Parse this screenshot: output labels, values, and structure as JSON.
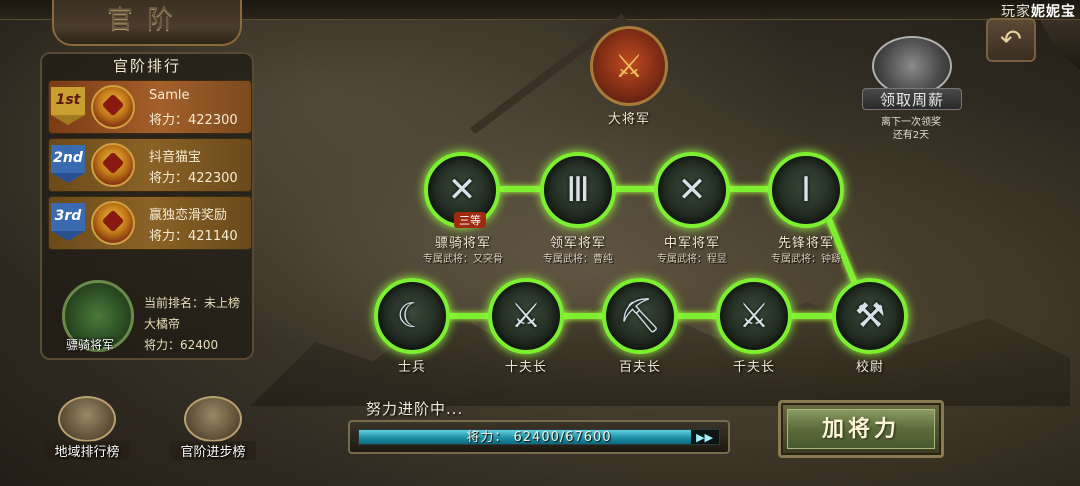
{
  "header": {
    "title": "官阶",
    "player_prefix": "玩家",
    "player_name": "妮妮宝"
  },
  "ranking": {
    "title": "官阶排行",
    "entries": [
      {
        "badge": "1st",
        "name": "Samle",
        "power_label": "将力：",
        "power": "422300"
      },
      {
        "badge": "2nd",
        "name": "抖音猫宝",
        "power_label": "将力：",
        "power": "422300"
      },
      {
        "badge": "3rd",
        "name": "赢独恋滑奖励",
        "power_label": "将力：",
        "power": "421140"
      }
    ],
    "mine": {
      "rank_title": "骠骑将军",
      "current_rank": "当前排名：未上榜",
      "name": "大橘帝",
      "power": "将力：62400"
    }
  },
  "buttons": {
    "region_rank": "地域排行榜",
    "progress_rank": "官阶进步榜",
    "add_power": "加将力",
    "salary": "领取周薪",
    "salary_note_1": "离下一次领奖",
    "salary_note_2": "还有2天"
  },
  "tree": {
    "top": {
      "label": "大将军"
    },
    "row1": [
      {
        "label": "骠骑将军",
        "sub": "专属武将：又突骨",
        "glyph": "✕",
        "badge": "三等"
      },
      {
        "label": "领军将军",
        "sub": "专属武将：曹纯",
        "glyph": "Ⅲ"
      },
      {
        "label": "中军将军",
        "sub": "专属武将：程昱",
        "glyph": "✕"
      },
      {
        "label": "先锋将军",
        "sub": "专属武将：钟繇",
        "glyph": "Ⅰ"
      }
    ],
    "row2": [
      {
        "label": "士兵",
        "glyph": "☾"
      },
      {
        "label": "十夫长",
        "glyph": "⚔"
      },
      {
        "label": "百夫长",
        "glyph": "⛏"
      },
      {
        "label": "千夫长",
        "glyph": "⚔"
      },
      {
        "label": "校尉",
        "glyph": "⚒"
      }
    ]
  },
  "progress": {
    "caption": "努力进阶中...",
    "text": "将力：  62400/67600",
    "current": 62400,
    "target": 67600,
    "arrows": "▶▶"
  },
  "colors": {
    "track_active": "#7cf030",
    "progress_fill": "#1a8aa0"
  }
}
